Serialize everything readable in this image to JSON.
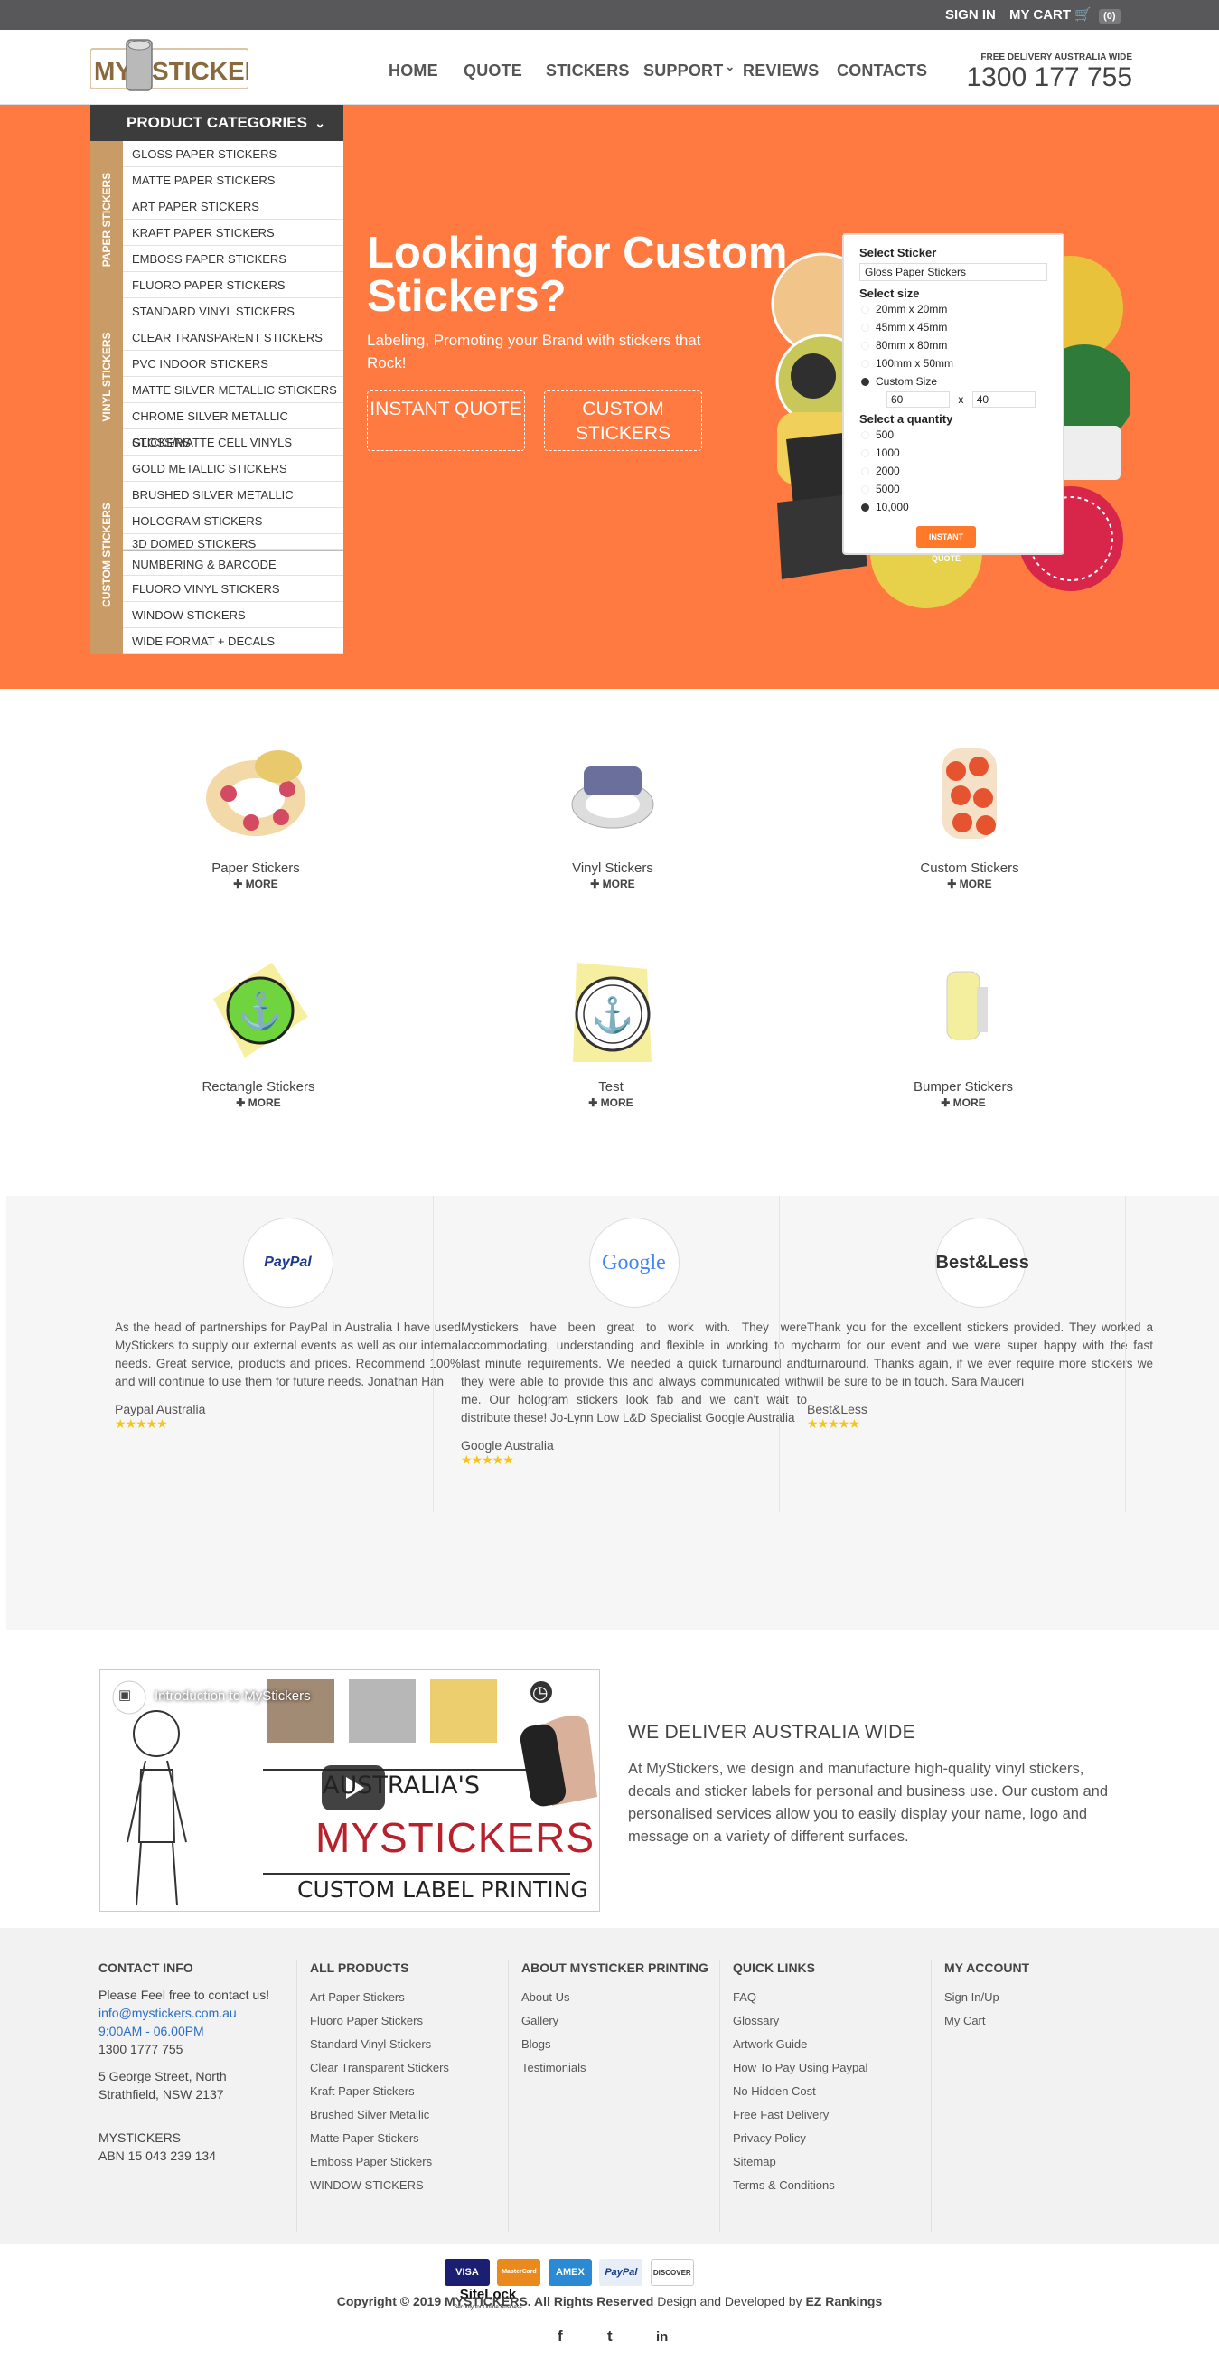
{
  "topbar": {
    "signin": "SIGN IN",
    "cart": "MY CART",
    "cart_count": "(0)"
  },
  "header": {
    "logo_text": "MY STICKERS",
    "nav": [
      "HOME",
      "QUOTE",
      "STICKERS",
      "SUPPORT",
      "REVIEWS",
      "CONTACTS"
    ],
    "free_delivery": "FREE DELIVERY AUSTRALIA WIDE",
    "phone": "1300 177 755"
  },
  "categories": {
    "title": "PRODUCT CATEGORIES",
    "groups": [
      {
        "label": "PAPER STICKERS",
        "items": [
          "GLOSS PAPER STICKERS",
          "MATTE PAPER STICKERS",
          "ART PAPER STICKERS",
          "KRAFT PAPER STICKERS",
          "EMBOSS PAPER STICKERS",
          "FLUORO PAPER STICKERS"
        ]
      },
      {
        "label": "VINYL STICKERS",
        "items": [
          "STANDARD VINYL STICKERS",
          "CLEAR TRANSPARENT STICKERS",
          "PVC INDOOR STICKERS",
          "MATTE SILVER METALLIC STICKERS",
          "CHROME SILVER METALLIC STICKERS",
          "GLOSS/MATTE CELL VINYLS"
        ]
      },
      {
        "label": "CUSTOM STICKERS",
        "items": [
          "GOLD METALLIC STICKERS",
          "BRUSHED SILVER METALLIC",
          "HOLOGRAM STICKERS",
          "3D DOMED STICKERS",
          "NUMBERING & BARCODE",
          "FLUORO VINYL STICKERS",
          "WINDOW STICKERS",
          "WIDE FORMAT + DECALS"
        ]
      }
    ]
  },
  "hero": {
    "title": "Looking for Custom Stickers?",
    "subtitle": "Labeling, Promoting your Brand with stickers that Rock!",
    "btn_instant": "INSTANT QUOTE",
    "btn_custom": "CUSTOM STICKERS"
  },
  "quote": {
    "select_sticker_label": "Select Sticker",
    "sticker_value": "Gloss Paper Stickers",
    "size_label": "Select size",
    "sizes": [
      "20mm x 20mm",
      "45mm x 45mm",
      "80mm x 80mm",
      "100mm x 50mm",
      "Custom Size"
    ],
    "selected_size": "Custom Size",
    "width": "60",
    "times": "x",
    "height": "40",
    "qty_label": "Select a quantity",
    "quantities": [
      "500",
      "1000",
      "2000",
      "5000",
      "10,000"
    ],
    "selected_qty": "10,000",
    "button": "INSTANT QUOTE"
  },
  "products": [
    {
      "name": "Paper Stickers",
      "more": "✚ MORE"
    },
    {
      "name": "Vinyl Stickers",
      "more": "✚ MORE"
    },
    {
      "name": "Custom Stickers",
      "more": "✚ MORE"
    },
    {
      "name": "Rectangle Stickers",
      "more": "✚ MORE"
    },
    {
      "name": "Test",
      "more": "✚ MORE"
    },
    {
      "name": "Bumper Stickers",
      "more": "✚ MORE"
    }
  ],
  "testimonials": [
    {
      "logo": "PayPal",
      "text": "As the head of partnerships for PayPal in Australia I have used MyStickers to supply our external events as well as our internal needs. Great service, products and prices. Recommend 100% and will continue to use them for future needs. Jonathan Han",
      "author": "Paypal Australia",
      "stars": "★★★★★"
    },
    {
      "logo": "Google",
      "text": "Mystickers have been great to work with. They were accommodating, understanding and flexible in working to my last minute requirements. We needed a quick turnaround and they were able to provide this and always communicated with me. Our hologram stickers look fab and we can't wait to distribute these! Jo-Lynn Low L&D Specialist Google Australia",
      "author": "Google Australia",
      "stars": "★★★★★"
    },
    {
      "logo": "Best&Less",
      "text": "Thank you for the excellent stickers provided. They worked a charm for our event and we were super happy with the fast turnaround. Thanks again, if we ever require more stickers we will be sure to be in touch. Sara Mauceri",
      "author": "Best&Less",
      "stars": "★★★★★"
    }
  ],
  "video": {
    "title": "Introduction to MyStickers",
    "line1": "AUSTRALIA'S",
    "line2": "MYSTICKERS",
    "line3": "CUSTOM LABEL PRINTING"
  },
  "deliver": {
    "heading": "WE DELIVER AUSTRALIA WIDE",
    "text": "At MyStickers, we design and manufacture high-quality vinyl stickers, decals and sticker labels for personal and business use. Our custom and personalised services allow you to easily display your name, logo and message on a variety of different surfaces."
  },
  "footer": {
    "contact": {
      "heading": "CONTACT INFO",
      "intro": "Please Feel free to contact us!",
      "email": "info@mystickers.com.au",
      "hours": "9:00AM - 06.00PM",
      "phone": "1300 1777 755",
      "address1": "5 George Street, North",
      "address2": "Strathfield, NSW 2137",
      "company": "MYSTICKERS",
      "abn": "ABN 15 043 239 134"
    },
    "all_products": {
      "heading": "ALL PRODUCTS",
      "links": [
        "Art Paper Stickers",
        "Fluoro Paper Stickers",
        "Standard Vinyl Stickers",
        "Clear Transparent Stickers",
        "Kraft Paper Stickers",
        "Brushed Silver Metallic",
        "Matte Paper Stickers",
        "Emboss Paper Stickers",
        "WINDOW STICKERS"
      ]
    },
    "about": {
      "heading": "ABOUT MYSTICKER PRINTING",
      "links": [
        "About Us",
        "Gallery",
        "Blogs",
        "Testimonials"
      ]
    },
    "quick": {
      "heading": "QUICK LINKS",
      "links": [
        "FAQ",
        "Glossary",
        "Artwork Guide",
        "How To Pay Using Paypal",
        "No Hidden Cost",
        "Free Fast Delivery",
        "Privacy Policy",
        "Sitemap",
        "Terms & Conditions"
      ]
    },
    "account": {
      "heading": "MY ACCOUNT",
      "links": [
        "Sign In/Up",
        "My Cart"
      ]
    }
  },
  "bottom": {
    "payments": [
      "VISA",
      "MasterCard",
      "AMEX",
      "PayPal",
      "DISCOVER",
      "SiteLock"
    ],
    "sitelock_sub": "Security for Online Business",
    "copyright": "Copyright © 2019 MYSTICKERS. All Rights Reserved",
    "designed": "Design and Developed by",
    "developer": "EZ Rankings",
    "social": [
      "f",
      "t",
      "in"
    ]
  },
  "colors": {
    "accent": "#fe7a40",
    "topbar": "#58585a",
    "category_side": "#c99c67",
    "link_blue": "#2a6fc4"
  }
}
